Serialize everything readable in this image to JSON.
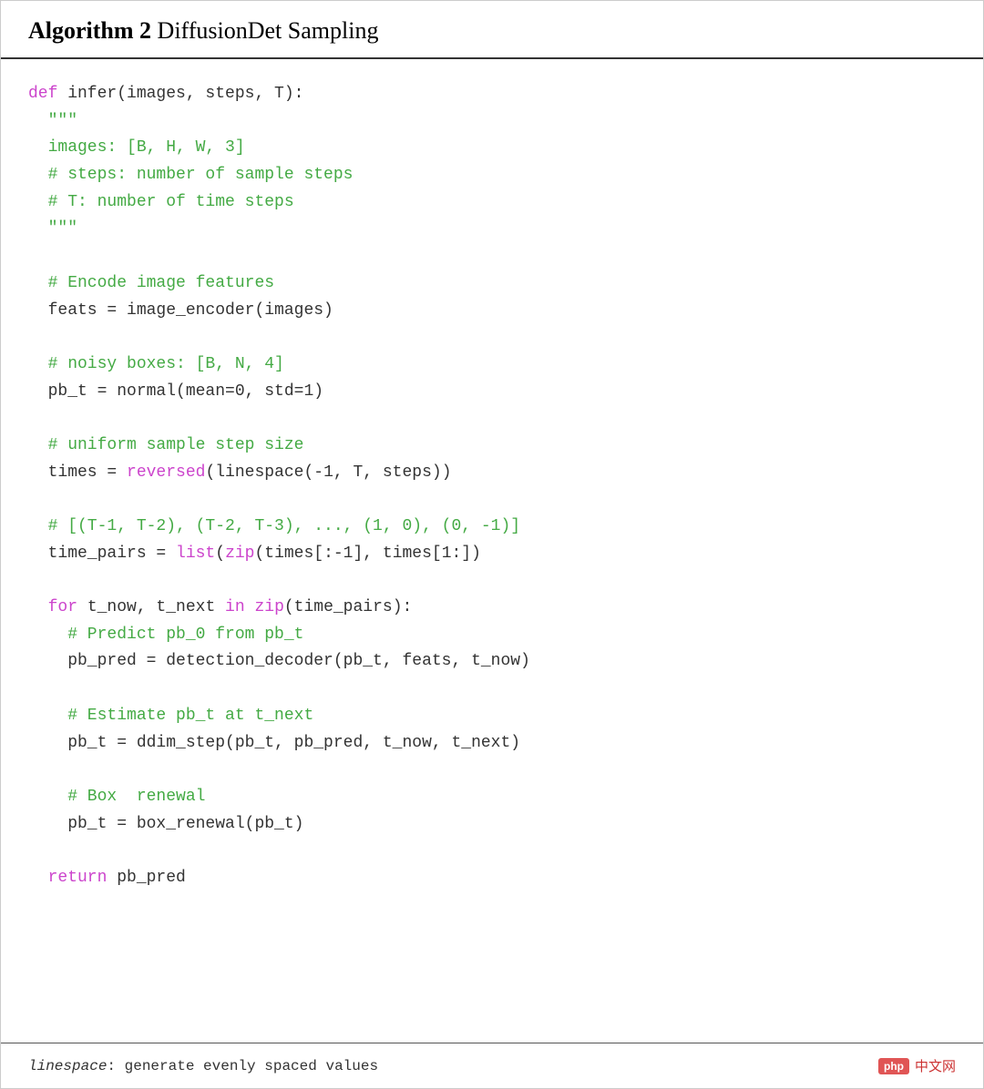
{
  "header": {
    "algorithm_label": "Algorithm 2",
    "algorithm_title": " DiffusionDet Sampling"
  },
  "code": {
    "lines": [
      {
        "type": "kw-line",
        "parts": [
          {
            "cls": "kw",
            "text": "def"
          },
          {
            "cls": "normal",
            "text": " infer(images, steps, T):"
          }
        ]
      },
      {
        "type": "indent1",
        "parts": [
          {
            "cls": "string",
            "text": "  \"\"\""
          }
        ]
      },
      {
        "type": "indent1",
        "parts": [
          {
            "cls": "string",
            "text": "  images: [B, H, W, 3]"
          }
        ]
      },
      {
        "type": "indent1",
        "parts": [
          {
            "cls": "string",
            "text": "  # steps: number of sample steps"
          }
        ]
      },
      {
        "type": "indent1",
        "parts": [
          {
            "cls": "string",
            "text": "  # T: number of time steps"
          }
        ]
      },
      {
        "type": "indent1",
        "parts": [
          {
            "cls": "string",
            "text": "  \"\"\""
          }
        ]
      },
      {
        "type": "blank"
      },
      {
        "type": "indent1",
        "parts": [
          {
            "cls": "comment",
            "text": "  # Encode image features"
          }
        ]
      },
      {
        "type": "indent1",
        "parts": [
          {
            "cls": "normal",
            "text": "  feats = image_encoder(images)"
          }
        ]
      },
      {
        "type": "blank"
      },
      {
        "type": "indent1",
        "parts": [
          {
            "cls": "comment",
            "text": "  # noisy boxes: [B, N, 4]"
          }
        ]
      },
      {
        "type": "indent1",
        "parts": [
          {
            "cls": "normal",
            "text": "  pb_t = normal(mean=0, std=1)"
          }
        ]
      },
      {
        "type": "blank"
      },
      {
        "type": "indent1",
        "parts": [
          {
            "cls": "comment",
            "text": "  # uniform sample step size"
          }
        ]
      },
      {
        "type": "indent1",
        "parts": [
          {
            "cls": "normal",
            "text": "  times = "
          },
          {
            "cls": "kw",
            "text": "reversed"
          },
          {
            "cls": "normal",
            "text": "(linespace(-1, T, steps))"
          }
        ]
      },
      {
        "type": "blank"
      },
      {
        "type": "indent1",
        "parts": [
          {
            "cls": "comment",
            "text": "  # [(T-1, T-2), (T-2, T-3), ..., (1, 0), (0, -1)]"
          }
        ]
      },
      {
        "type": "indent1",
        "parts": [
          {
            "cls": "normal",
            "text": "  time_pairs = "
          },
          {
            "cls": "builtin",
            "text": "list"
          },
          {
            "cls": "normal",
            "text": "("
          },
          {
            "cls": "builtin",
            "text": "zip"
          },
          {
            "cls": "normal",
            "text": "(times[:-1], times[1:])"
          }
        ]
      },
      {
        "type": "blank"
      },
      {
        "type": "kw-loop",
        "parts": [
          {
            "cls": "kw",
            "text": "  for"
          },
          {
            "cls": "normal",
            "text": " t_now, t_next "
          },
          {
            "cls": "kw",
            "text": "in"
          },
          {
            "cls": "normal",
            "text": " "
          },
          {
            "cls": "builtin",
            "text": "zip"
          },
          {
            "cls": "normal",
            "text": "(time_pairs):"
          }
        ]
      },
      {
        "type": "indent2",
        "parts": [
          {
            "cls": "comment",
            "text": "    # Predict pb_0 from pb_t"
          }
        ]
      },
      {
        "type": "indent2",
        "parts": [
          {
            "cls": "normal",
            "text": "    pb_pred = detection_decoder(pb_t, feats, t_now)"
          }
        ]
      },
      {
        "type": "blank"
      },
      {
        "type": "indent2",
        "parts": [
          {
            "cls": "comment",
            "text": "    # Estimate pb_t at t_next"
          }
        ]
      },
      {
        "type": "indent2",
        "parts": [
          {
            "cls": "normal",
            "text": "    pb_t = ddim_step(pb_t, pb_pred, t_now, t_next)"
          }
        ]
      },
      {
        "type": "blank"
      },
      {
        "type": "indent2",
        "parts": [
          {
            "cls": "comment",
            "text": "    # Box  renewal"
          }
        ]
      },
      {
        "type": "indent2",
        "parts": [
          {
            "cls": "normal",
            "text": "    pb_t = box_renewal(pb_t)"
          }
        ]
      },
      {
        "type": "blank"
      },
      {
        "type": "return-line",
        "parts": [
          {
            "cls": "kw",
            "text": "  return"
          },
          {
            "cls": "normal",
            "text": " pb_pred"
          }
        ]
      }
    ]
  },
  "footer": {
    "definition_code": "linespace",
    "definition_text": ": generate evenly spaced values",
    "php_label": "php",
    "site_label": "中文网"
  }
}
